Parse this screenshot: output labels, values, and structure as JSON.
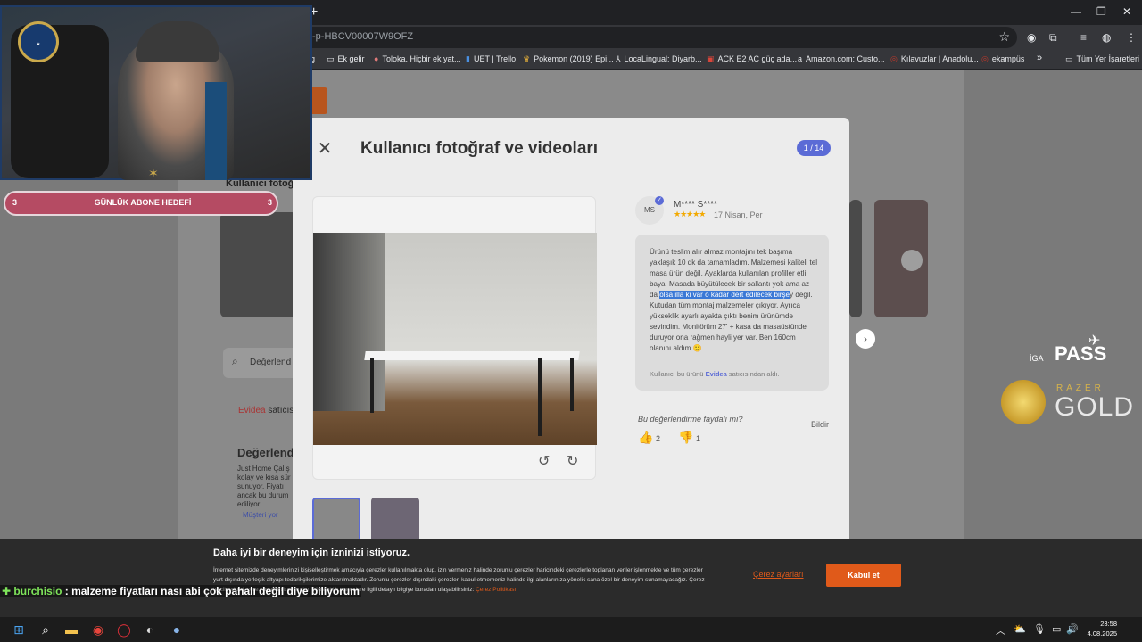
{
  "browser": {
    "url": "-p-HBCV00007W9OFZ",
    "bookmarks": [
      "g",
      "Ek gelir",
      "Toloka. Hiçbir ek yat...",
      "UET | Trello",
      "Pokemon (2019) Epi...",
      "LocaLingual: Diyarb...",
      "ACK E2 AC güç ada...",
      "Amazon.com: Custo...",
      "Kılavuzlar | Anadolu...",
      "ekampüs",
      "»",
      "Tüm Yer İşaretleri"
    ]
  },
  "background_page": {
    "section_label": "Kullanıcı fotoğ",
    "search_placeholder": "Değerlend",
    "seller_prefix": "Evidea",
    "seller_suffix": "satıcıs",
    "heading": "Değerlend",
    "body": "Just Home Çalış kolay ve kısa sür sunuyor. Fiyatı ancak bu durum ediliyor.",
    "link": "Müşteri yor"
  },
  "modal": {
    "title": "Kullanıcı fotoğraf ve videoları",
    "counter": "1 / 14",
    "reviewer": {
      "initials": "MS",
      "name": "M**** S****",
      "stars": "★★★★★",
      "date": "17 Nisan, Per"
    },
    "review_before": "Ürünü teslim alır almaz montajını tek başıma yaklaşık 10 dk da tamamladım. Malzemesi kaliteli tel masa ürün değil. Ayaklarda kullanılan profiller etli baya. Masada büyütülecek bir sallantı yok ama az da ",
    "review_highlight": "olsa illa ki var o kadar dert edilecek birşe",
    "review_after": "y değil. Kutudan tüm montaj malzemeler çıkıyor. Ayrıca yükseklik ayarlı ayakta çıktı benim ürünümde sevindim. Monitörüm 27' + kasa da masaüstünde duruyor ona rağmen hayli yer var. Ben 160cm olanını aldım 🙂",
    "seller_line_prefix": "Kullanıcı bu ürünü",
    "seller_name": "Evidea",
    "seller_line_suffix": "satıcısından aldı.",
    "helpful_question": "Bu değerlendirme faydalı mı?",
    "report": "Bildir",
    "likes": "2",
    "dislikes": "1"
  },
  "cookie": {
    "title": "Daha iyi bir deneyim için izninizi istiyoruz.",
    "text": "İnternet sitemizde deneyimlerinizi kişiselleştirmek amacıyla çerezler kullanılmakta olup, izin vermeniz halinde zorunlu çerezler haricindeki çerezlerle toplanan veriler işlenmekte ve tüm çerezler yurt dışında yerleşik altyapı tedarikçilerimize aktarılmaktadır. Zorunlu çerezler dışındaki çerezleri kabul etmemeniz halinde ilgi alanlarınıza yönelik sana özel bir deneyim sunamayacağız. Çerez tercihlerinizi, çerez ayarları kısmından yönetebilir, çerezlere ilgili detaylı bilgiye buradan ulaşabilirsiniz:",
    "policy_link": "Çerez Politikası",
    "settings": "Çerez ayarları",
    "accept": "Kabul et"
  },
  "stream": {
    "goal_label": "GÜNLÜK ABONE HEDEFİ",
    "goal_current": "3",
    "goal_target": "3",
    "chat_user": "burchisio",
    "chat_message": ": malzeme fiyatları nası abi çok pahalı değil diye biliyorum",
    "sponsor1": "PASS",
    "sponsor1_small": "İGA",
    "sponsor2_small": "RAZER",
    "sponsor2": "GOLD"
  },
  "taskbar": {
    "time": "23:58",
    "date": "4.08.2025"
  },
  "colors": {
    "accent": "#5b6bd6",
    "orange": "#e05a1a",
    "highlight": "#3a78d6"
  }
}
